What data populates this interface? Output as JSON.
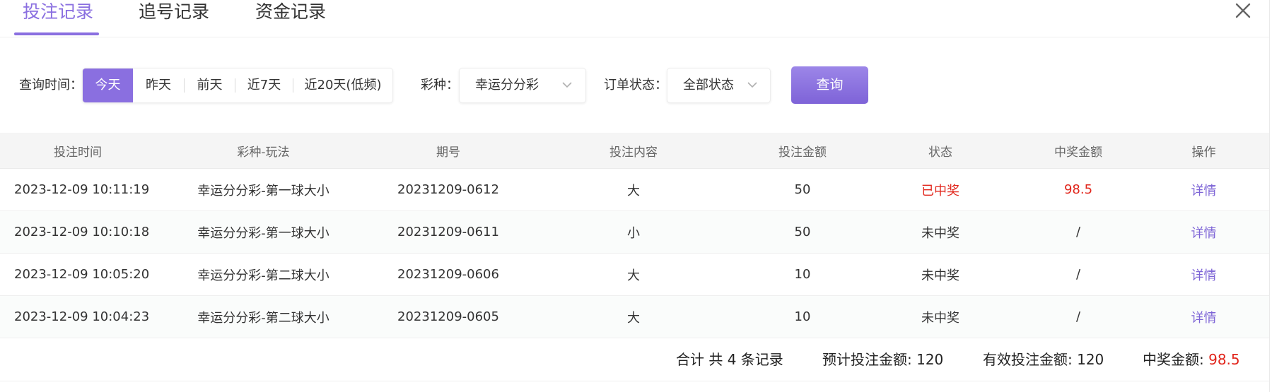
{
  "tabs": [
    {
      "label": "投注记录",
      "active": true
    },
    {
      "label": "追号记录",
      "active": false
    },
    {
      "label": "资金记录",
      "active": false
    }
  ],
  "filters": {
    "time_label": "查询时间：",
    "time_options": [
      {
        "label": "今天",
        "active": true
      },
      {
        "label": "昨天",
        "active": false
      },
      {
        "label": "前天",
        "active": false
      },
      {
        "label": "近7天",
        "active": false
      },
      {
        "label": "近20天(低频)",
        "active": false
      }
    ],
    "lottery_label": "彩种：",
    "lottery_value": "幸运分分彩",
    "status_label": "订单状态：",
    "status_value": "全部状态",
    "query_label": "查询"
  },
  "table": {
    "headers": [
      "投注时间",
      "彩种-玩法",
      "期号",
      "投注内容",
      "投注金额",
      "状态",
      "中奖金额",
      "操作"
    ],
    "rows": [
      {
        "time": "2023-12-09 10:11:19",
        "game": "幸运分分彩-第一球大小",
        "issue": "20231209-0612",
        "content": "大",
        "amount": "50",
        "status": "已中奖",
        "prize": "98.5",
        "action": "详情",
        "won": true
      },
      {
        "time": "2023-12-09 10:10:18",
        "game": "幸运分分彩-第一球大小",
        "issue": "20231209-0611",
        "content": "小",
        "amount": "50",
        "status": "未中奖",
        "prize": "/",
        "action": "详情",
        "won": false
      },
      {
        "time": "2023-12-09 10:05:20",
        "game": "幸运分分彩-第二球大小",
        "issue": "20231209-0606",
        "content": "大",
        "amount": "10",
        "status": "未中奖",
        "prize": "/",
        "action": "详情",
        "won": false
      },
      {
        "time": "2023-12-09 10:04:23",
        "game": "幸运分分彩-第二球大小",
        "issue": "20231209-0605",
        "content": "大",
        "amount": "10",
        "status": "未中奖",
        "prize": "/",
        "action": "详情",
        "won": false
      }
    ]
  },
  "summary": {
    "total": "合计 共 4 条记录",
    "expected_label": "预计投注金额: ",
    "expected_value": "120",
    "valid_label": "有效投注金额: ",
    "valid_value": "120",
    "prize_label": "中奖金额: ",
    "prize_value": "98.5"
  },
  "colors": {
    "accent": "#8a6fe0",
    "win_red": "#e1251b",
    "link": "#7d64d6"
  },
  "icons": {
    "close": "close-icon",
    "dropdown": "chevron-down-icon"
  }
}
